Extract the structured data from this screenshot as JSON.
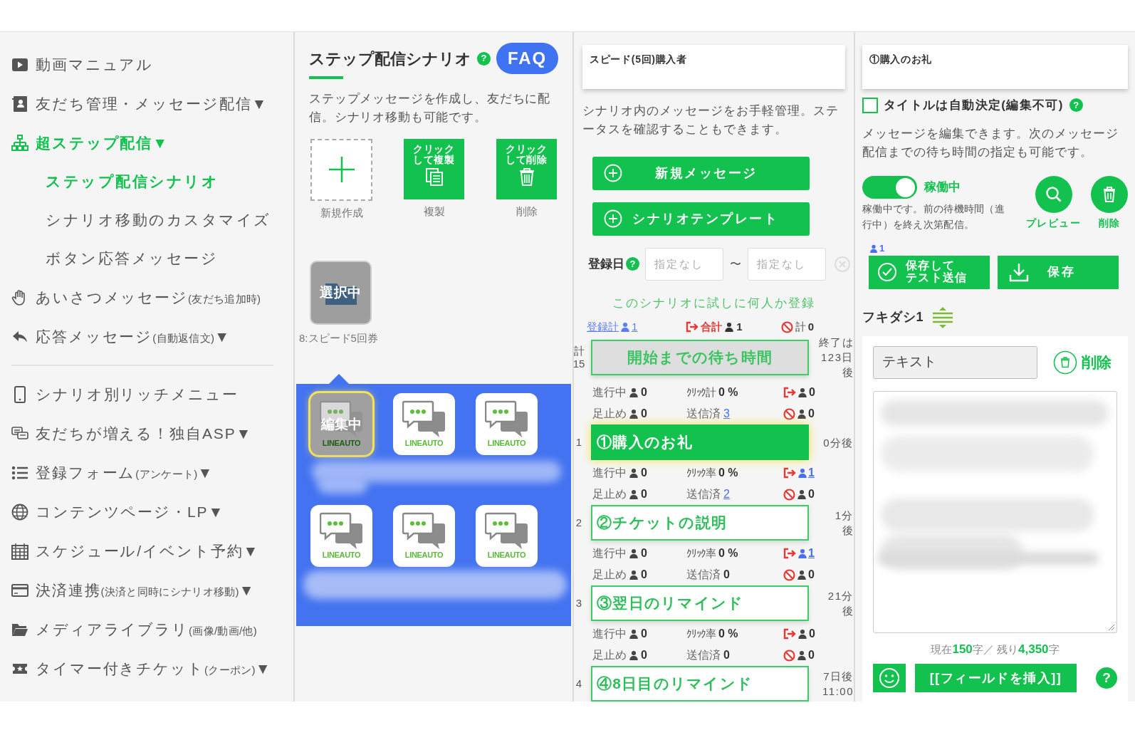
{
  "sidebar": {
    "groups": [
      [
        {
          "label": "動画マニュアル",
          "selected": false
        },
        {
          "label": "友だち管理・メッセージ配信",
          "arrow": "▼",
          "selected": false
        },
        {
          "label": "超ステップ配信",
          "arrow": "▼",
          "selected": true,
          "children": [
            {
              "label": "ステップ配信シナリオ",
              "selected": true
            },
            {
              "label": "シナリオ移動のカスタマイズ",
              "selected": false
            },
            {
              "label": "ボタン応答メッセージ",
              "selected": false
            }
          ]
        },
        {
          "label": "あいさつメッセージ",
          "note": "(友だち追加時)",
          "selected": false
        },
        {
          "label": "応答メッセージ",
          "note": "(自動返信文)",
          "arrow": "▼",
          "selected": false
        }
      ],
      [
        {
          "label": "シナリオ別リッチメニュー",
          "selected": false
        },
        {
          "label": "友だちが増える！独自ASP",
          "arrow": "▼",
          "selected": false
        },
        {
          "label": "登録フォーム",
          "note": "(アンケート)",
          "arrow": "▼",
          "selected": false
        },
        {
          "label": "コンテンツページ・LP",
          "arrow": "▼",
          "selected": false
        },
        {
          "label": "スケジュール/イベント予約",
          "arrow": "▼",
          "selected": false
        },
        {
          "label": "決済連携",
          "note": "(決済と同時にシナリオ移動)",
          "arrow": "▼",
          "selected": false
        },
        {
          "label": "メディアライブラリ",
          "note": "(画像/動画/他)",
          "selected": false
        },
        {
          "label": "タイマー付きチケット",
          "note": "(クーポン)",
          "arrow": "▼",
          "selected": false
        }
      ]
    ]
  },
  "scenarios": {
    "title": "ステップ配信シナリオ",
    "help": "?",
    "faq": "FAQ",
    "description": "ステップメッセージを作成し、友だちに配信。シナリオ移動も可能です。",
    "actions": [
      {
        "kind": "new",
        "caption": "新規作成"
      },
      {
        "kind": "copy",
        "text": "クリックして複製",
        "caption": "複製"
      },
      {
        "kind": "delete",
        "text": "クリックして削除",
        "caption": "削除"
      }
    ],
    "folders": [
      {
        "badge": "選択中",
        "caption": "8:スピード5回券",
        "selected": true
      }
    ],
    "messages": [
      {
        "logo": "LINEAUTO",
        "badge": "編集中",
        "selected": true
      },
      {
        "logo": "LINEAUTO",
        "selected": false
      },
      {
        "logo": "LINEAUTO",
        "selected": false
      },
      {
        "logo": "LINEAUTO",
        "selected": false
      },
      {
        "logo": "LINEAUTO",
        "selected": false
      },
      {
        "logo": "LINEAUTO",
        "selected": false
      }
    ]
  },
  "scenario": {
    "name": "スピード(5回)購入者",
    "description": "シナリオ内のメッセージをお手軽管理。ステータスを確認することもできます。",
    "buttons": [
      "新規メッセージ",
      "シナリオテンプレート"
    ],
    "filter": {
      "label": "登録日",
      "help": "?",
      "from_placeholder": "指定なし",
      "separator": "〜",
      "to_placeholder": "指定なし"
    },
    "trial_link": "このシナリオに試しに何人か登録",
    "totals": {
      "registered_label": "登録計",
      "registered": "1",
      "exit_label": "合計",
      "exit": "1",
      "blocked_label": "計",
      "blocked": "0"
    },
    "steps": [
      {
        "kind": "start",
        "index": [
          "計",
          "15"
        ],
        "title": "開始までの待ち時間",
        "wait": [
          "終了は",
          "123日",
          "後"
        ],
        "selected": false,
        "stats": {
          "active_label": "進行中",
          "active": "0",
          "click_label": "ｸﾘｯｸ計",
          "click": "0 %",
          "exit": "0",
          "exit_link": false,
          "stopped_label": "足止め",
          "stopped": "0",
          "sent_label": "送信済",
          "sent": "3",
          "sent_link": true,
          "blocked": "0"
        }
      },
      {
        "kind": "message",
        "index": [
          "1"
        ],
        "title": "①購入のお礼",
        "wait": [
          "0分後"
        ],
        "selected": true,
        "stats": {
          "active_label": "進行中",
          "active": "0",
          "click_label": "ｸﾘｯｸ率",
          "click": "0 %",
          "exit": "1",
          "exit_link": true,
          "stopped_label": "足止め",
          "stopped": "0",
          "sent_label": "送信済",
          "sent": "2",
          "sent_link": true,
          "blocked": "0"
        }
      },
      {
        "kind": "message",
        "index": [
          "2"
        ],
        "title": "②チケットの説明",
        "wait": [
          "1分",
          "後"
        ],
        "selected": false,
        "stats": {
          "active_label": "進行中",
          "active": "0",
          "click_label": "ｸﾘｯｸ率",
          "click": "0 %",
          "exit": "1",
          "exit_link": true,
          "stopped_label": "足止め",
          "stopped": "0",
          "sent_label": "送信済",
          "sent": "0",
          "sent_link": false,
          "blocked": "0"
        }
      },
      {
        "kind": "message",
        "index": [
          "3"
        ],
        "title": "③翌日のリマインド",
        "wait": [
          "21分",
          "後"
        ],
        "selected": false,
        "stats": {
          "active_label": "進行中",
          "active": "0",
          "click_label": "ｸﾘｯｸ率",
          "click": "0 %",
          "exit": "0",
          "exit_link": false,
          "stopped_label": "足止め",
          "stopped": "0",
          "sent_label": "送信済",
          "sent": "0",
          "sent_link": false,
          "blocked": "0"
        }
      },
      {
        "kind": "message",
        "index": [
          "4"
        ],
        "title": "④8日目のリマインド",
        "wait": [
          "7日後",
          "11:00"
        ],
        "selected": false
      }
    ]
  },
  "editor": {
    "title": "①購入のお礼",
    "auto_title": {
      "label": "タイトルは自動決定(編集不可)",
      "checked": false,
      "help": "?"
    },
    "description": "メッセージを編集できます。次のメッセージ配信までの待ち時間の指定も可能です。",
    "status": {
      "on": true,
      "label": "稼働中",
      "note": "稼働中です。前の待機時間（進行中）を終え次第配信。"
    },
    "preview": "プレビュー",
    "delete": "削除",
    "recipients": "1",
    "save_test": [
      "保存して",
      "テスト送信"
    ],
    "save": "保存",
    "bubble": {
      "title": "フキダシ1",
      "type": "テキスト",
      "delete": "削除",
      "counter": "現在**150**字／ 残り**4,350**字",
      "insert_field": "[[フィールドを挿入]]",
      "help": "?"
    }
  }
}
